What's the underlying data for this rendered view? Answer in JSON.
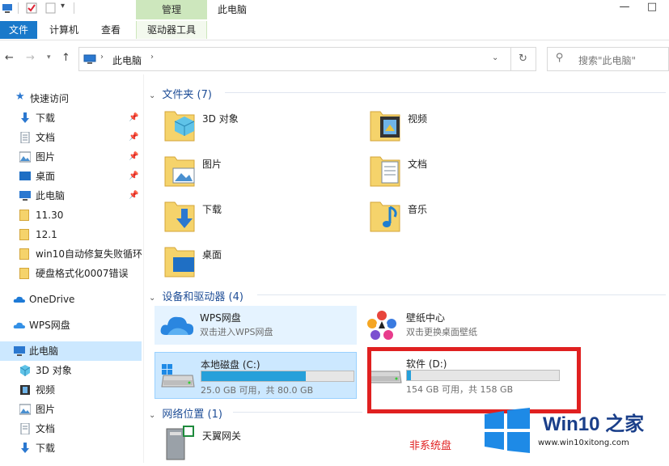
{
  "ribbon": {
    "context_header": "管理",
    "window_title": "此电脑",
    "tabs": [
      {
        "label": "文件"
      },
      {
        "label": "计算机"
      },
      {
        "label": "查看"
      },
      {
        "label": "驱动器工具"
      }
    ],
    "controls": [
      "—",
      "□",
      "✕"
    ]
  },
  "address": {
    "path": "此电脑",
    "search_placeholder": "搜索\"此电脑\""
  },
  "nav": {
    "quick_access": "快速访问",
    "quick_items": [
      {
        "label": "下载",
        "icon": "download-icon"
      },
      {
        "label": "文档",
        "icon": "document-icon"
      },
      {
        "label": "图片",
        "icon": "picture-icon"
      },
      {
        "label": "桌面",
        "icon": "desktop-icon"
      },
      {
        "label": "此电脑",
        "icon": "computer-icon"
      },
      {
        "label": "11.30",
        "icon": "folder-icon"
      },
      {
        "label": "12.1",
        "icon": "folder-icon"
      },
      {
        "label": "win10自动修复失败循环",
        "icon": "folder-icon"
      },
      {
        "label": "硬盘格式化0007错误",
        "icon": "folder-icon"
      }
    ],
    "onedrive": "OneDrive",
    "wps": "WPS网盘",
    "this_pc": "此电脑",
    "pc_items": [
      {
        "label": "3D 对象"
      },
      {
        "label": "视频"
      },
      {
        "label": "图片"
      },
      {
        "label": "文档"
      },
      {
        "label": "下载"
      }
    ]
  },
  "content": {
    "folders_header": "文件夹 (7)",
    "folders": [
      {
        "label": "3D 对象"
      },
      {
        "label": "视频"
      },
      {
        "label": "图片"
      },
      {
        "label": "文档"
      },
      {
        "label": "下载"
      },
      {
        "label": "音乐"
      },
      {
        "label": "桌面"
      }
    ],
    "devices_header": "设备和驱动器 (4)",
    "devices": [
      {
        "name": "WPS网盘",
        "sub": "双击进入WPS网盘"
      },
      {
        "name": "壁纸中心",
        "sub": "双击更换桌面壁纸"
      },
      {
        "name": "本地磁盘 (C:)",
        "sub": "25.0 GB 可用，共 80.0 GB",
        "used_fraction": 0.6875
      },
      {
        "name": "软件 (D:)",
        "sub": "154 GB 可用，共 158 GB",
        "used_fraction": 0.025
      }
    ],
    "network_header": "网络位置 (1)",
    "network": [
      {
        "label": "天翼网关"
      }
    ]
  },
  "annotation": {
    "note": "非系统盘",
    "highlight_color": "#e02020"
  },
  "watermark": {
    "brand": "Win10 之家",
    "url": "www.win10xitong.com"
  },
  "colors": {
    "accent": "#1979ca",
    "drive_bar": "#26a0da",
    "context_tab": "#cde7bd"
  }
}
